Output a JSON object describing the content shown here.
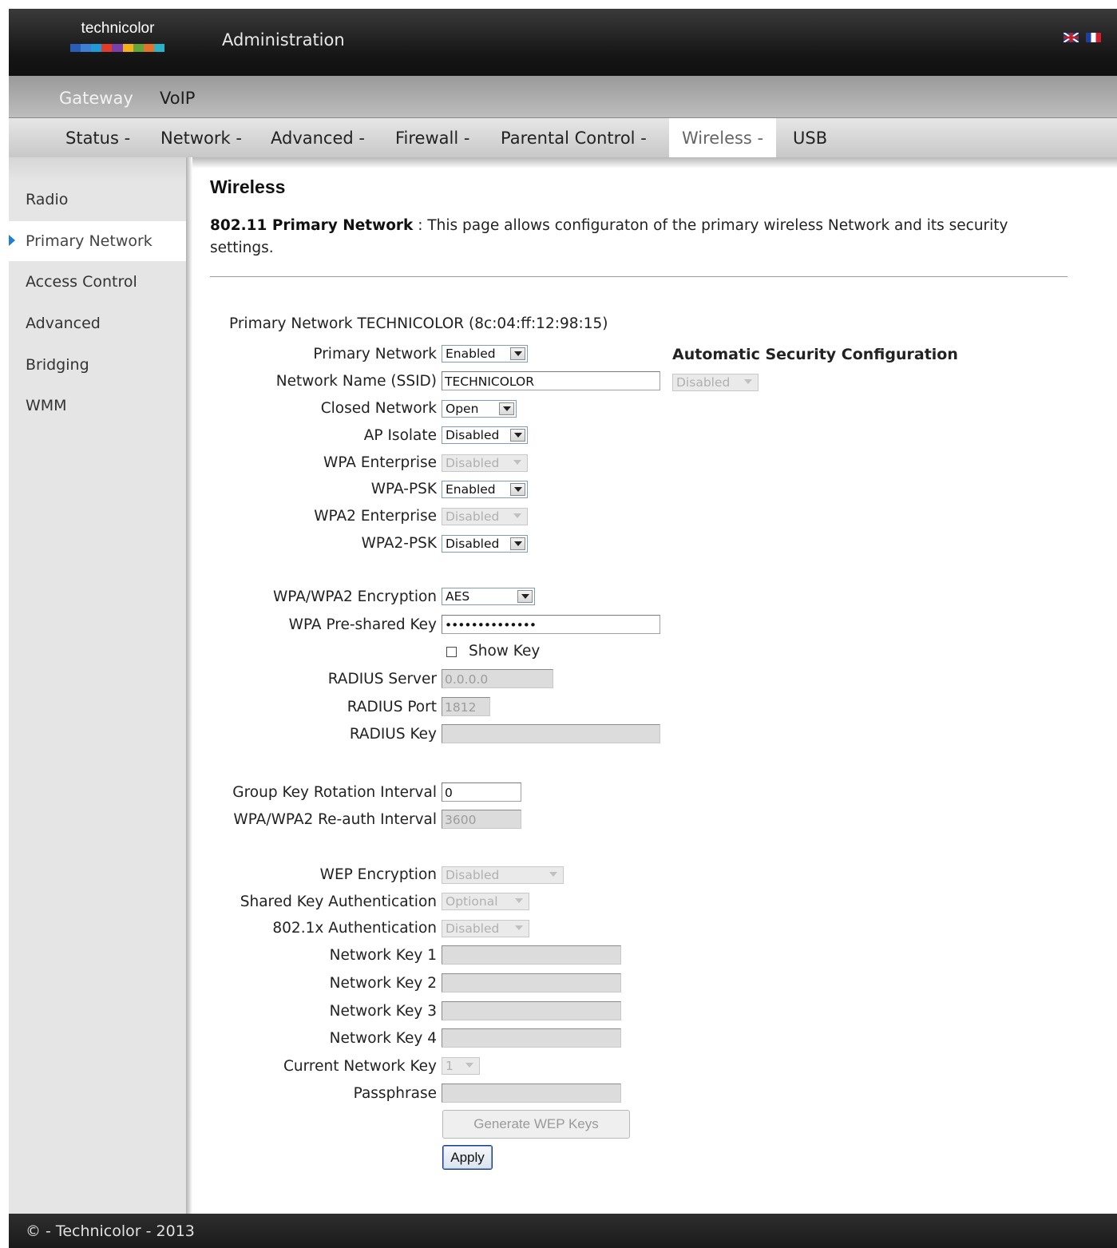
{
  "header": {
    "logo_text": "technicolor",
    "title": "Administration",
    "logo_colors": [
      "#2a5db5",
      "#3d7fd1",
      "#1e9ad6",
      "#e23b2a",
      "#7a3fa8",
      "#f3b21b",
      "#63a63a",
      "#e6712a",
      "#2bb1c8"
    ],
    "languages": [
      "uk-flag-icon",
      "fr-flag-icon"
    ]
  },
  "nav1": {
    "gateway": "Gateway",
    "voip": "VoIP"
  },
  "nav2": {
    "items": [
      "Status -",
      "Network -",
      "Advanced -",
      "Firewall -",
      "Parental Control -",
      "Wireless -",
      "USB"
    ],
    "active": "Wireless -"
  },
  "sidebar": {
    "items": [
      "Radio",
      "Primary Network",
      "Access Control",
      "Advanced",
      "Bridging",
      "WMM"
    ],
    "active": "Primary Network",
    "arrow_color": "#1f7fd4"
  },
  "page": {
    "title": "Wireless",
    "desc_bold": "802.11 Primary Network",
    "desc_sep": " : ",
    "desc_text": "This page allows configuraton of the primary wireless Network and its security settings."
  },
  "form": {
    "network_heading": "Primary Network TECHNICOLOR (8c:04:ff:12:98:15)",
    "auto_security_label": "Automatic Security Configuration",
    "auto_security_value": "Disabled",
    "primary_network": {
      "label": "Primary Network",
      "value": "Enabled"
    },
    "ssid": {
      "label": "Network Name (SSID)",
      "value": "TECHNICOLOR"
    },
    "closed_network": {
      "label": "Closed Network",
      "value": "Open"
    },
    "ap_isolate": {
      "label": "AP Isolate",
      "value": "Disabled"
    },
    "wpa_enterprise": {
      "label": "WPA Enterprise",
      "value": "Disabled"
    },
    "wpa_psk": {
      "label": "WPA-PSK",
      "value": "Enabled"
    },
    "wpa2_enterprise": {
      "label": "WPA2 Enterprise",
      "value": "Disabled"
    },
    "wpa2_psk": {
      "label": "WPA2-PSK",
      "value": "Disabled"
    },
    "encryption": {
      "label": "WPA/WPA2 Encryption",
      "value": "AES"
    },
    "psk": {
      "label": "WPA Pre-shared Key",
      "value": "••••••••••••••"
    },
    "show_key": "Show Key",
    "radius_server": {
      "label": "RADIUS Server",
      "value": "0.0.0.0"
    },
    "radius_port": {
      "label": "RADIUS Port",
      "value": "1812"
    },
    "radius_key": {
      "label": "RADIUS Key",
      "value": ""
    },
    "group_key": {
      "label": "Group Key Rotation Interval",
      "value": "0"
    },
    "reauth": {
      "label": "WPA/WPA2 Re-auth Interval",
      "value": "3600"
    },
    "wep_encryption": {
      "label": "WEP Encryption",
      "value": "Disabled"
    },
    "shared_key_auth": {
      "label": "Shared Key Authentication",
      "value": "Optional"
    },
    "dot1x_auth": {
      "label": "802.1x Authentication",
      "value": "Disabled"
    },
    "key1": {
      "label": "Network Key 1",
      "value": ""
    },
    "key2": {
      "label": "Network Key 2",
      "value": ""
    },
    "key3": {
      "label": "Network Key 3",
      "value": ""
    },
    "key4": {
      "label": "Network Key 4",
      "value": ""
    },
    "current_key": {
      "label": "Current Network Key",
      "value": "1"
    },
    "passphrase": {
      "label": "Passphrase",
      "value": ""
    },
    "generate_button": "Generate WEP Keys",
    "apply_button": "Apply"
  },
  "footer": {
    "text": "© - Technicolor - 2013"
  }
}
